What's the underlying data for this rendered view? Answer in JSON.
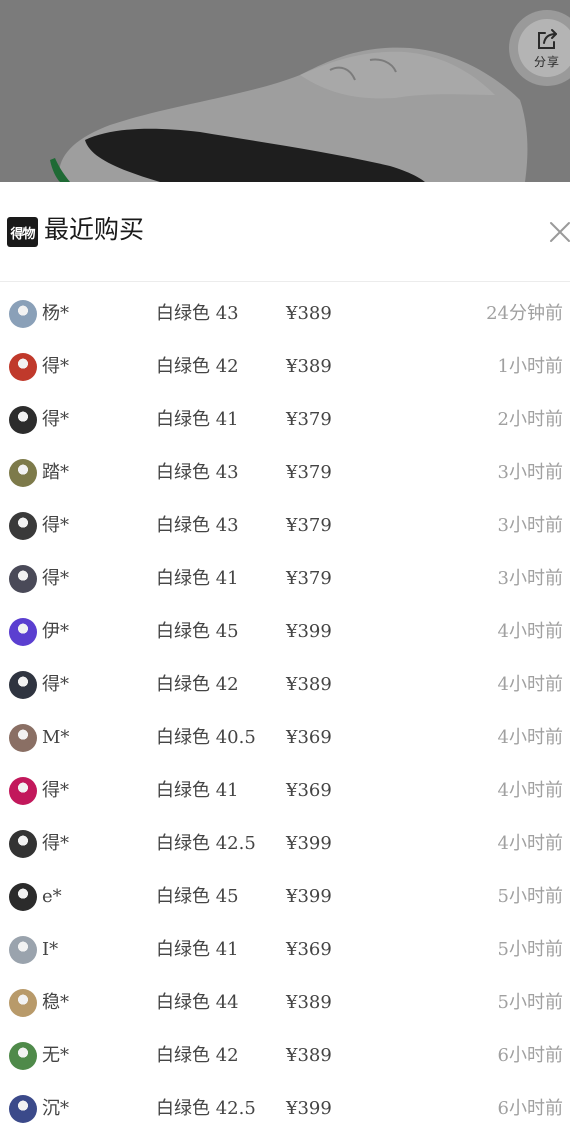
{
  "hero": {
    "share_label": "分享"
  },
  "sheet": {
    "brand_logo_text": "得物",
    "title": "最近购买"
  },
  "purchases": [
    {
      "buyer": "杨*",
      "spec": "白绿色 43",
      "price": "¥389",
      "time": "24分钟前",
      "avatar_color": "#8aa0b8"
    },
    {
      "buyer": "得*",
      "spec": "白绿色 42",
      "price": "¥389",
      "time": "1小时前",
      "avatar_color": "#c0392b"
    },
    {
      "buyer": "得*",
      "spec": "白绿色 41",
      "price": "¥379",
      "time": "2小时前",
      "avatar_color": "#2c2c2c"
    },
    {
      "buyer": "踏*",
      "spec": "白绿色 43",
      "price": "¥379",
      "time": "3小时前",
      "avatar_color": "#7d7a4a"
    },
    {
      "buyer": "得*",
      "spec": "白绿色 43",
      "price": "¥379",
      "time": "3小时前",
      "avatar_color": "#3a3a3a"
    },
    {
      "buyer": "得*",
      "spec": "白绿色 41",
      "price": "¥379",
      "time": "3小时前",
      "avatar_color": "#4a4a58"
    },
    {
      "buyer": "伊*",
      "spec": "白绿色 45",
      "price": "¥399",
      "time": "4小时前",
      "avatar_color": "#5b3fd0"
    },
    {
      "buyer": "得*",
      "spec": "白绿色 42",
      "price": "¥389",
      "time": "4小时前",
      "avatar_color": "#2f3440"
    },
    {
      "buyer": "M*",
      "spec": "白绿色 40.5",
      "price": "¥369",
      "time": "4小时前",
      "avatar_color": "#8a6f64"
    },
    {
      "buyer": "得*",
      "spec": "白绿色 41",
      "price": "¥369",
      "time": "4小时前",
      "avatar_color": "#c2185b"
    },
    {
      "buyer": "得*",
      "spec": "白绿色 42.5",
      "price": "¥399",
      "time": "4小时前",
      "avatar_color": "#333333"
    },
    {
      "buyer": "e*",
      "spec": "白绿色 45",
      "price": "¥399",
      "time": "5小时前",
      "avatar_color": "#2b2b2b"
    },
    {
      "buyer": "I*",
      "spec": "白绿色 41",
      "price": "¥369",
      "time": "5小时前",
      "avatar_color": "#9aa3ad"
    },
    {
      "buyer": "稳*",
      "spec": "白绿色 44",
      "price": "¥389",
      "time": "5小时前",
      "avatar_color": "#b89a6a"
    },
    {
      "buyer": "无*",
      "spec": "白绿色 42",
      "price": "¥389",
      "time": "6小时前",
      "avatar_color": "#4f8a4a"
    },
    {
      "buyer": "沉*",
      "spec": "白绿色 42.5",
      "price": "¥399",
      "time": "6小时前",
      "avatar_color": "#3b4a8a"
    }
  ]
}
